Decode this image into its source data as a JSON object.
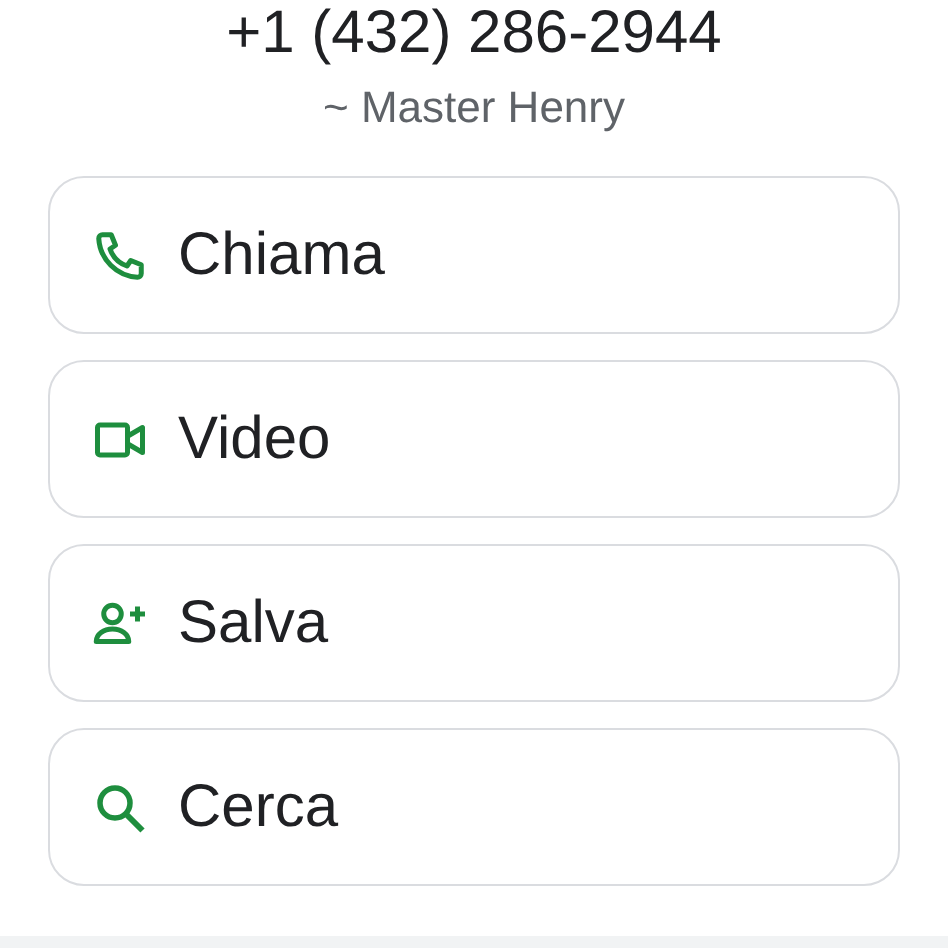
{
  "contact": {
    "phone": "+1 (432) 286-2944",
    "name": "~ Master Henry"
  },
  "actions": [
    {
      "kind": "call",
      "label": "Chiama"
    },
    {
      "kind": "video",
      "label": "Video"
    },
    {
      "kind": "save",
      "label": "Salva"
    },
    {
      "kind": "search",
      "label": "Cerca"
    }
  ]
}
